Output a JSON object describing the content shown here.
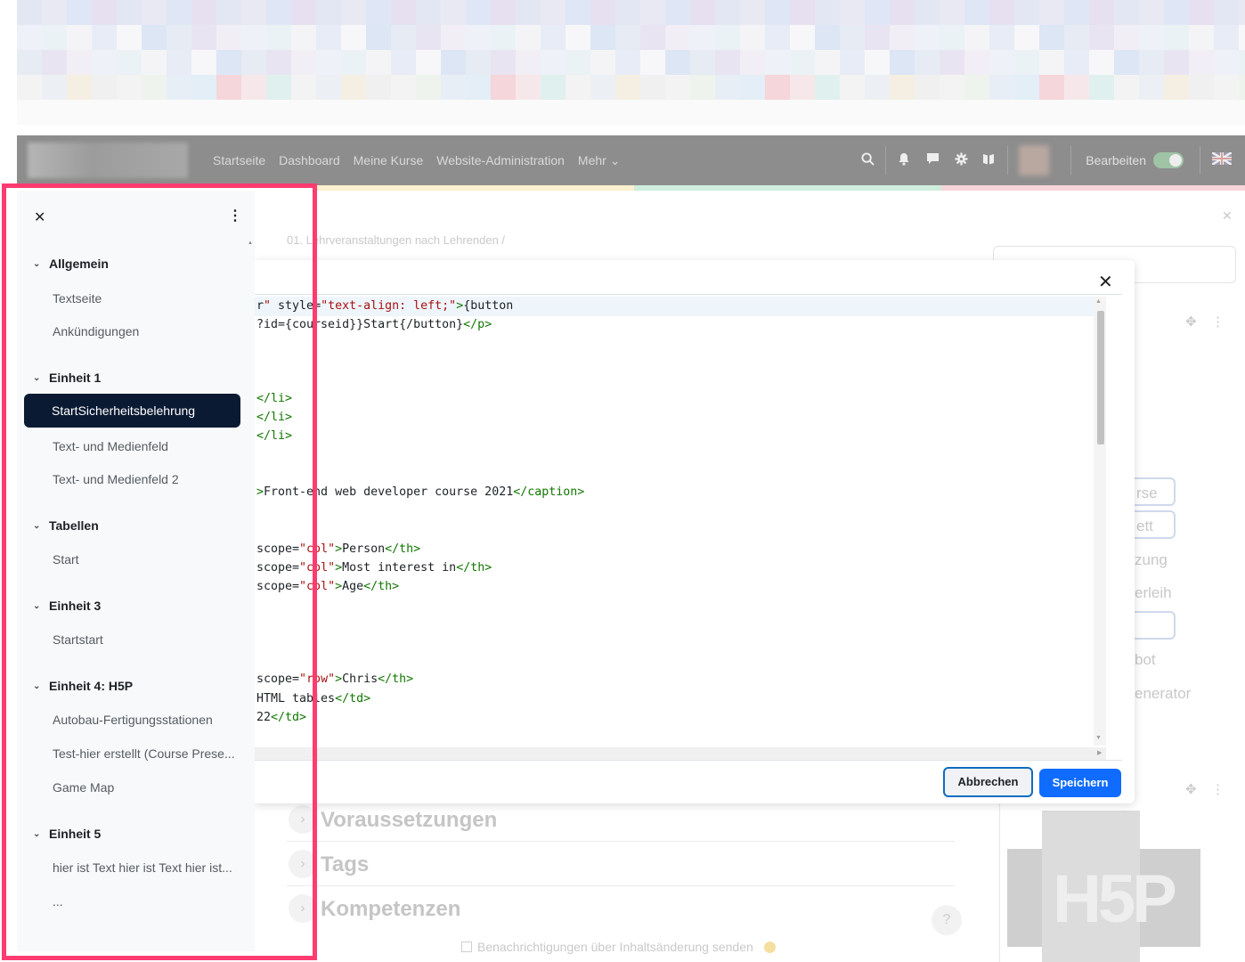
{
  "navbar": {
    "links": [
      "Startseite",
      "Dashboard",
      "Meine Kurse",
      "Website-Administration",
      "Mehr"
    ],
    "icons": [
      "search-icon",
      "bell-icon",
      "chat-icon",
      "gear-icon",
      "book-icon"
    ],
    "edit_label": "Bearbeiten",
    "language_icon": "flag-uk-icon"
  },
  "breadcrumb": "01. Lehrveranstaltungen nach Lehrenden /",
  "right_panel": {
    "buttons": [
      "rse",
      "ett"
    ],
    "texts": [
      "zung",
      "erleih",
      "bot",
      "enerator"
    ]
  },
  "sections": [
    "Voraussetzungen",
    "Tags",
    "Kompetenzen"
  ],
  "notify_label": "Benachrichtigungen über Inhaltsänderung senden",
  "h5p_logo_text": "H5P",
  "modal": {
    "code_lines": [
      "r\" style=\"text-align: left;\">{button",
      "?id={courseid}}Start{/button}</p>",
      "</li>",
      "</li>",
      "</li>",
      ">Front-end web developer course 2021</caption>",
      "scope=\"col\">Person</th>",
      "scope=\"col\">Most interest in</th>",
      "scope=\"col\">Age</th>",
      "scope=\"row\">Chris</th>",
      "HTML tables</td>",
      "22</td>"
    ],
    "cancel_label": "Abbrechen",
    "save_label": "Speichern"
  },
  "drawer": {
    "sections": [
      {
        "title": "Allgemein",
        "items": [
          "Textseite",
          "Ankündigungen"
        ]
      },
      {
        "title": "Einheit 1",
        "active_item": "StartSicherheitsbelehrung",
        "items": [
          "Text- und Medienfeld",
          "Text- und Medienfeld 2"
        ]
      },
      {
        "title": "Tabellen",
        "items": [
          "Start"
        ]
      },
      {
        "title": "Einheit 3",
        "items": [
          "Startstart"
        ]
      },
      {
        "title": "Einheit 4: H5P",
        "items": [
          "Autobau-Fertigungsstationen",
          "Test-hier erstellt (Course Prese...",
          "Game Map"
        ]
      },
      {
        "title": "Einheit 5",
        "items": [
          "hier ist Text hier ist Text hier ist...",
          "..."
        ]
      }
    ]
  },
  "colors": {
    "highlight": "#ff3b6f",
    "active_item_bg": "#0b1a33",
    "primary": "#0f6cff"
  }
}
